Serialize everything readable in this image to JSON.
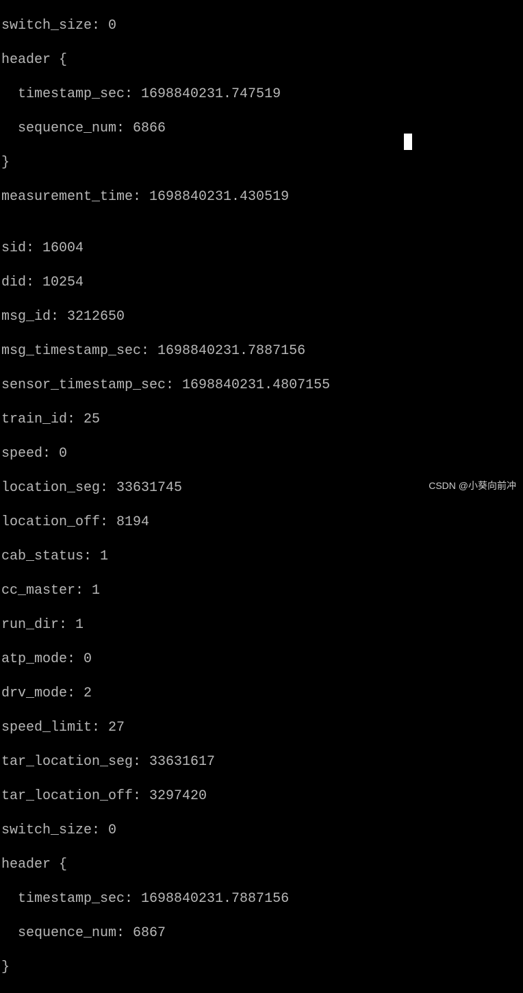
{
  "lines": {
    "l0": "switch_size: 0",
    "l1": "header {",
    "l2": "  timestamp_sec: 1698840231.747519",
    "l3": "  sequence_num: 6866",
    "l4": "}",
    "l5": "measurement_time: 1698840231.430519",
    "l6": "",
    "l7": "sid: 16004",
    "l8": "did: 10254",
    "l9": "msg_id: 3212650",
    "l10": "msg_timestamp_sec: 1698840231.7887156",
    "l11": "sensor_timestamp_sec: 1698840231.4807155",
    "l12": "train_id: 25",
    "l13": "speed: 0",
    "l14": "location_seg: 33631745",
    "l15": "location_off: 8194",
    "l16": "cab_status: 1",
    "l17": "cc_master: 1",
    "l18": "run_dir: 1",
    "l19": "atp_mode: 0",
    "l20": "drv_mode: 2",
    "l21": "speed_limit: 27",
    "l22": "tar_location_seg: 33631617",
    "l23": "tar_location_off: 3297420",
    "l24": "switch_size: 0",
    "l25": "header {",
    "l26": "  timestamp_sec: 1698840231.7887156",
    "l27": "  sequence_num: 6867",
    "l28": "}"
  },
  "watermark": "CSDN @小葵向前冲"
}
